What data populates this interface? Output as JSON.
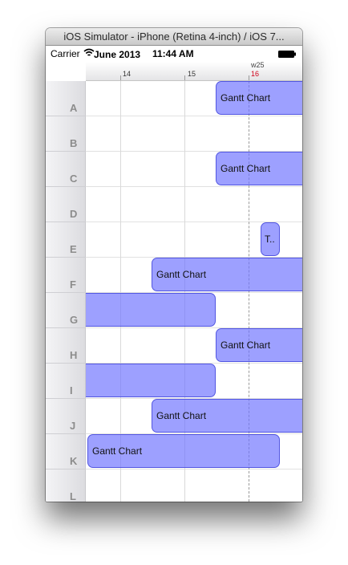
{
  "window": {
    "title": "iOS Simulator - iPhone (Retina 4-inch) / iOS 7..."
  },
  "status_bar": {
    "carrier": "Carrier",
    "header_month": "June 2013",
    "time": "11:44 AM",
    "icons": [
      "wifi-icon",
      "battery-icon"
    ]
  },
  "timeline": {
    "ticks": [
      "14",
      "15",
      "16"
    ],
    "week_label": "w25",
    "today_label": "16",
    "today_color": "#d0021b"
  },
  "rows": [
    {
      "label": "A"
    },
    {
      "label": "B"
    },
    {
      "label": "C"
    },
    {
      "label": "D"
    },
    {
      "label": "E"
    },
    {
      "label": "F"
    },
    {
      "label": "G"
    },
    {
      "label": "H"
    },
    {
      "label": "I"
    },
    {
      "label": "J"
    },
    {
      "label": "K"
    },
    {
      "label": "L"
    }
  ],
  "bars": [
    {
      "row": "A",
      "label": "Gantt Chart"
    },
    {
      "row": "C",
      "label": "Gantt Chart"
    },
    {
      "row": "E",
      "label": "T.."
    },
    {
      "row": "F",
      "label": "Gantt Chart"
    },
    {
      "row": "G",
      "label": ""
    },
    {
      "row": "H",
      "label": "Gantt Chart"
    },
    {
      "row": "I",
      "label": ""
    },
    {
      "row": "J",
      "label": "Gantt Chart"
    },
    {
      "row": "K",
      "label": "Gantt Chart"
    }
  ],
  "colors": {
    "bar_fill": "#8d91ff",
    "bar_border": "#4a4fdc"
  }
}
